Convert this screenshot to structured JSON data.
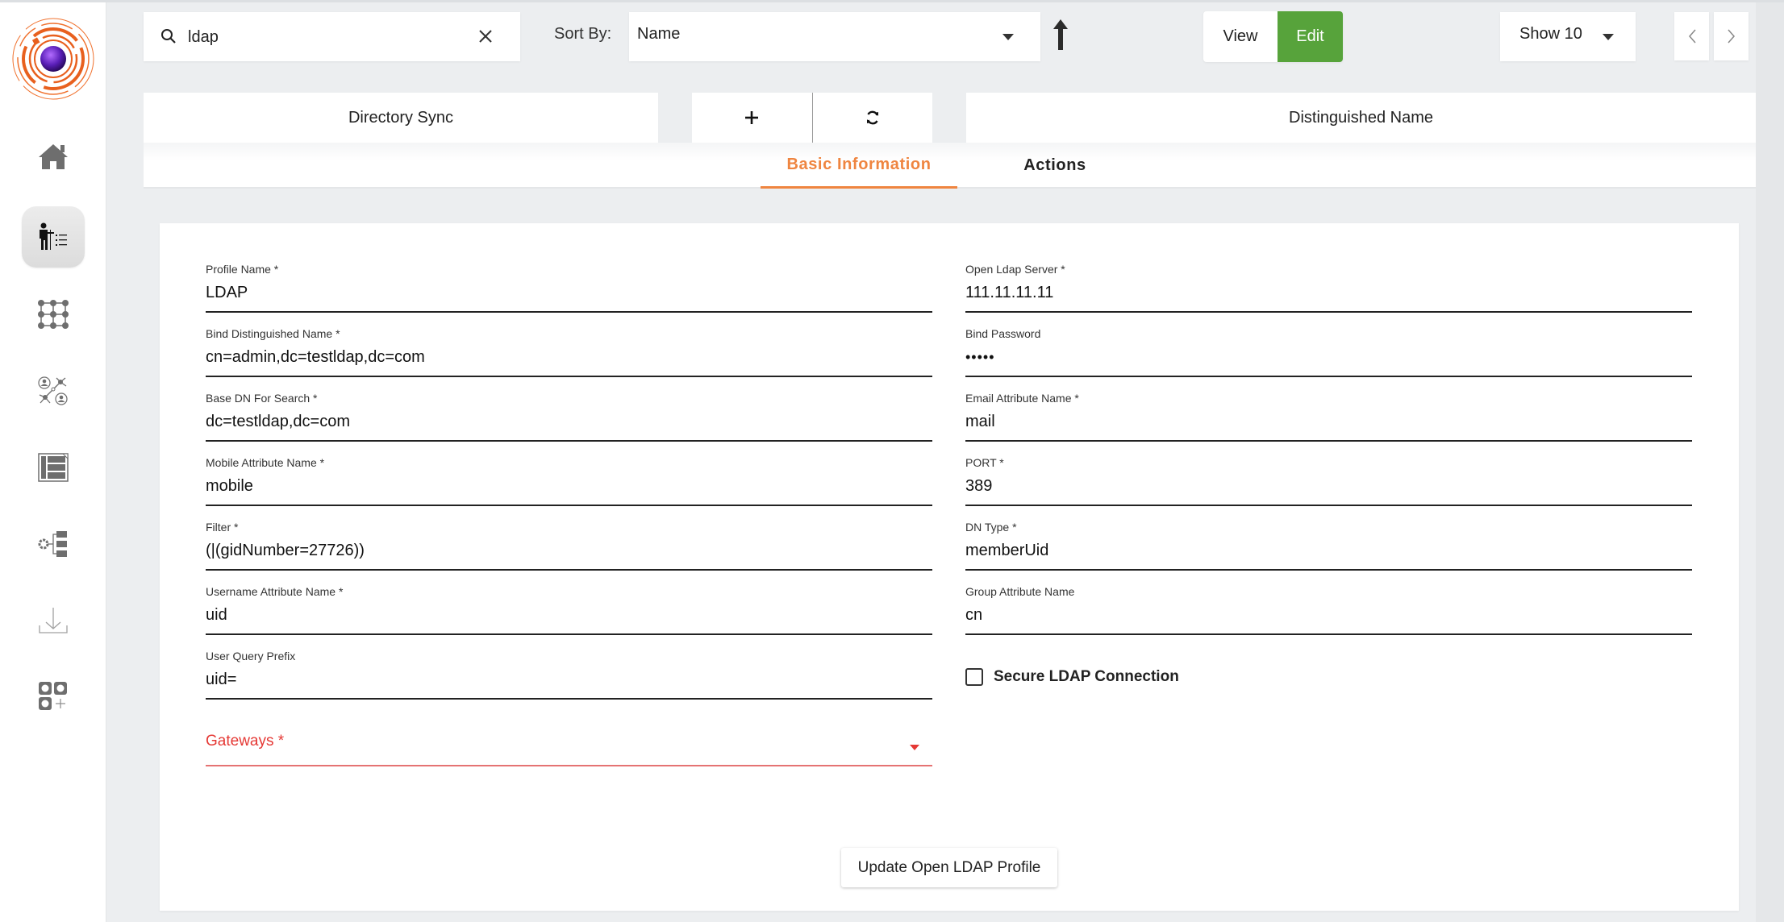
{
  "sidebar": {
    "logo": "app-logo",
    "items": [
      {
        "name": "home",
        "icon": "home-icon",
        "active": false
      },
      {
        "name": "directory-sync",
        "icon": "person-list-icon",
        "active": true
      },
      {
        "name": "grid",
        "icon": "dot-grid-icon",
        "active": false
      },
      {
        "name": "network",
        "icon": "user-network-icon",
        "active": false
      },
      {
        "name": "layout",
        "icon": "layout-list-icon",
        "active": false
      },
      {
        "name": "settings-folders",
        "icon": "gear-folders-icon",
        "active": false
      },
      {
        "name": "download",
        "icon": "download-icon",
        "active": false
      },
      {
        "name": "add-apps",
        "icon": "apps-add-icon",
        "active": false
      }
    ]
  },
  "toolbar": {
    "search_value": "ldap",
    "sort_label": "Sort By:",
    "sort_value": "Name",
    "sort_direction": "ascending",
    "view_label": "View",
    "edit_label": "Edit",
    "mode_active": "Edit",
    "show_value": "Show 10"
  },
  "panel": {
    "directory_sync": "Directory Sync",
    "add_symbol": "+",
    "distinguished_name": "Distinguished Name"
  },
  "tabs": [
    {
      "label": "Basic Information",
      "active": true
    },
    {
      "label": "Actions",
      "active": false
    }
  ],
  "form": {
    "left": [
      {
        "label": "Profile Name *",
        "value": "LDAP"
      },
      {
        "label": "Bind Distinguished Name *",
        "value": "cn=admin,dc=testldap,dc=com"
      },
      {
        "label": "Base DN For Search *",
        "value": "dc=testldap,dc=com"
      },
      {
        "label": "Mobile Attribute Name *",
        "value": "mobile"
      },
      {
        "label": "Filter *",
        "value": "(|(gidNumber=27726))"
      },
      {
        "label": "Username Attribute Name *",
        "value": "uid"
      },
      {
        "label": "User Query Prefix",
        "value": "uid="
      }
    ],
    "right": [
      {
        "label": "Open Ldap Server *",
        "value": "111.11.11.11"
      },
      {
        "label": "Bind Password",
        "value": "•••••"
      },
      {
        "label": "Email Attribute Name *",
        "value": "mail"
      },
      {
        "label": "PORT *",
        "value": "389"
      },
      {
        "label": "DN Type *",
        "value": "memberUid"
      },
      {
        "label": "Group Attribute Name",
        "value": "cn"
      }
    ],
    "secure_ldap": {
      "label": "Secure LDAP Connection",
      "checked": false
    },
    "gateways": {
      "label": "Gateways *",
      "value": ""
    },
    "submit_label": "Update Open LDAP Profile"
  },
  "colors": {
    "accent": "#ef8540",
    "edit_green": "#57a33b",
    "error": "#e53935",
    "background": "#eceef0"
  }
}
